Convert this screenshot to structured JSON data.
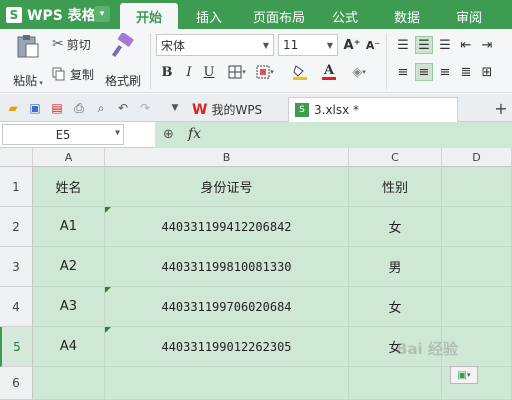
{
  "app": {
    "logo": "S",
    "title": "WPS 表格",
    "menu_arrow": "▾"
  },
  "ribbon_tabs": [
    "开始",
    "插入",
    "页面布局",
    "公式",
    "数据",
    "审阅"
  ],
  "ribbon": {
    "paste": "粘贴",
    "cut": "剪切",
    "copy": "复制",
    "format_painter": "格式刷",
    "font_name": "宋体",
    "font_size": "11",
    "bold": "B",
    "italic": "I",
    "underline": "U",
    "grow_font": "A⁺",
    "shrink_font": "A⁻",
    "font_color_letter": "A",
    "fill_color": "#f5c400",
    "font_color": "#e02020"
  },
  "quickbar": {
    "doc_tabs": [
      {
        "label": "我的WPS"
      },
      {
        "label": "3.xlsx *"
      }
    ],
    "add_tab": "+"
  },
  "formula_bar": {
    "name_box": "E5",
    "fx_label": "fx",
    "formula": ""
  },
  "sheet": {
    "columns": [
      "A",
      "B",
      "C",
      "D"
    ],
    "rows": [
      "1",
      "2",
      "3",
      "4",
      "5",
      "6"
    ],
    "active_row": "5",
    "cells": [
      [
        "姓名",
        "身份证号",
        "性别",
        ""
      ],
      [
        "A1",
        "440331199412206842",
        "女",
        ""
      ],
      [
        "A2",
        "440331199810081330",
        "男",
        ""
      ],
      [
        "A3",
        "440331199706020684",
        "女",
        ""
      ],
      [
        "A4",
        "440331199012262305",
        "女",
        ""
      ],
      [
        "",
        "",
        "",
        ""
      ]
    ]
  },
  "watermark": "Bai 经验",
  "paste_options_icon": "paste-options-icon",
  "colors": {
    "accent": "#3e9b52",
    "selection_fill": "#cfe8d6"
  }
}
